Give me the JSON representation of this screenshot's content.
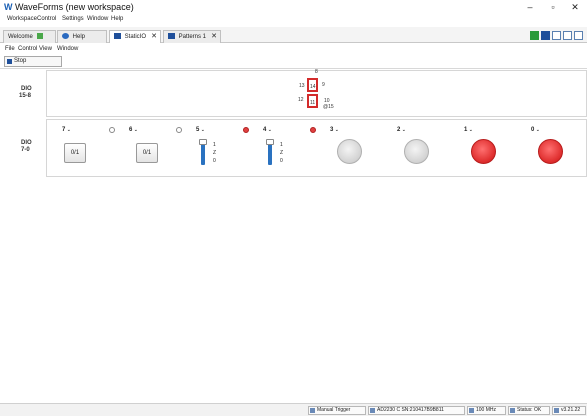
{
  "app": {
    "title": "WaveForms (new workspace)",
    "logo": "W"
  },
  "window_controls": {
    "minimize": "–",
    "maximize": "▫",
    "close": "✕"
  },
  "main_menu": [
    "Workspace",
    "Control",
    "Settings",
    "Window",
    "Help"
  ],
  "tabs": [
    {
      "label": "Welcome",
      "icon": "plus-icon",
      "closable": false,
      "active": false
    },
    {
      "label": "Help",
      "icon": "help-icon",
      "closable": false,
      "active": false
    },
    {
      "label": "StaticIO",
      "icon": "staticio-icon",
      "closable": true,
      "active": true,
      "close": "✕"
    },
    {
      "label": "Patterns 1",
      "icon": "patterns-icon",
      "closable": true,
      "active": false,
      "close": "✕"
    }
  ],
  "instrument_menu": [
    "File",
    "Control",
    "View",
    "Window"
  ],
  "toolbar": {
    "stop_label": "Stop"
  },
  "groups": {
    "dio_15_8": {
      "label_line1": "DIO",
      "label_line2": "15-8"
    },
    "dio_7_0": {
      "label_line1": "DIO",
      "label_line2": "7-0"
    }
  },
  "seven_segment": {
    "labels": [
      "8",
      "13",
      "14",
      "9",
      "12",
      "11",
      "10",
      "@15"
    ]
  },
  "channels": [
    {
      "title": "7",
      "type": "button",
      "button_label": "0/1",
      "radio_on": false
    },
    {
      "title": "6",
      "type": "button",
      "button_label": "0/1",
      "radio_on": false
    },
    {
      "title": "5",
      "type": "slider",
      "ticks": [
        "1",
        "Z",
        "0"
      ],
      "radio_on": true
    },
    {
      "title": "4",
      "type": "slider",
      "ticks": [
        "1",
        "Z",
        "0"
      ],
      "radio_on": true
    },
    {
      "title": "3",
      "type": "led",
      "led_on": false
    },
    {
      "title": "2",
      "type": "led",
      "led_on": false
    },
    {
      "title": "1",
      "type": "led",
      "led_on": true
    },
    {
      "title": "0",
      "type": "led",
      "led_on": true
    }
  ],
  "status_bar": {
    "trigger": "Manual Trigger",
    "device": "AD2230 C SN:210417B9B811",
    "clock": "100 MHz",
    "status": "Status: OK",
    "version": "v3.21.22"
  },
  "colors": {
    "accent": "#2a72c0",
    "led_on": "#e03030",
    "seg_red": "#d32b2b"
  }
}
